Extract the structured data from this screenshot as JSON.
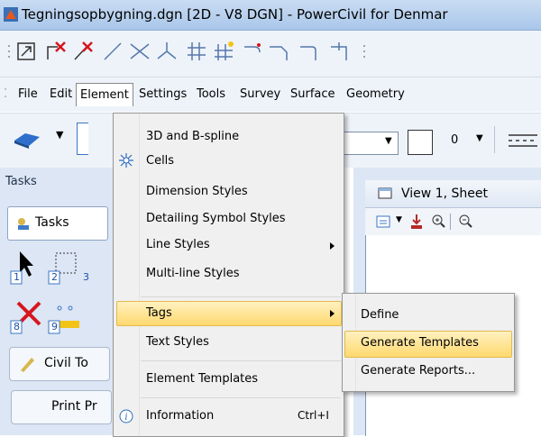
{
  "window": {
    "title": "Tegningsopbygning.dgn [2D - V8 DGN] - PowerCivil for Denmar"
  },
  "menubar": {
    "items": [
      "File",
      "Edit",
      "Element",
      "Settings",
      "Tools",
      "Survey",
      "Surface",
      "Geometry"
    ],
    "active": "Element"
  },
  "toolbar2": {
    "number_value": "0"
  },
  "tasks": {
    "header": "Tasks",
    "tab_label": "Tasks",
    "civil_button": "Civil To",
    "print_button": "Print Pr",
    "icon_numbers": [
      "1",
      "2",
      "3",
      "8",
      "9"
    ]
  },
  "view": {
    "title": "View 1, Sheet"
  },
  "element_menu": {
    "items": [
      {
        "label": "3D and B-spline",
        "submenu": false,
        "icon": null
      },
      {
        "label": "Cells",
        "submenu": false,
        "icon": "cells-icon"
      },
      {
        "label": "Dimension Styles",
        "submenu": false,
        "icon": null
      },
      {
        "label": "Detailing Symbol Styles",
        "submenu": false,
        "icon": null
      },
      {
        "label": "Line Styles",
        "submenu": true,
        "icon": null
      },
      {
        "label": "Multi-line Styles",
        "submenu": false,
        "icon": null
      },
      {
        "label": "Tags",
        "submenu": true,
        "icon": null,
        "highlighted": true
      },
      {
        "label": "Text Styles",
        "submenu": false,
        "icon": null
      },
      {
        "label": "Element Templates",
        "submenu": false,
        "icon": null
      },
      {
        "label": "Information",
        "submenu": false,
        "icon": "info-icon",
        "shortcut": "Ctrl+I"
      }
    ]
  },
  "tags_submenu": {
    "items": [
      {
        "label": "Define",
        "highlighted": false
      },
      {
        "label": "Generate Templates",
        "highlighted": true
      },
      {
        "label": "Generate Reports...",
        "highlighted": false
      }
    ]
  },
  "colors": {
    "highlight": "#ffd96f",
    "titlebar": "#a9c6ea",
    "panel": "#dce6f4"
  }
}
